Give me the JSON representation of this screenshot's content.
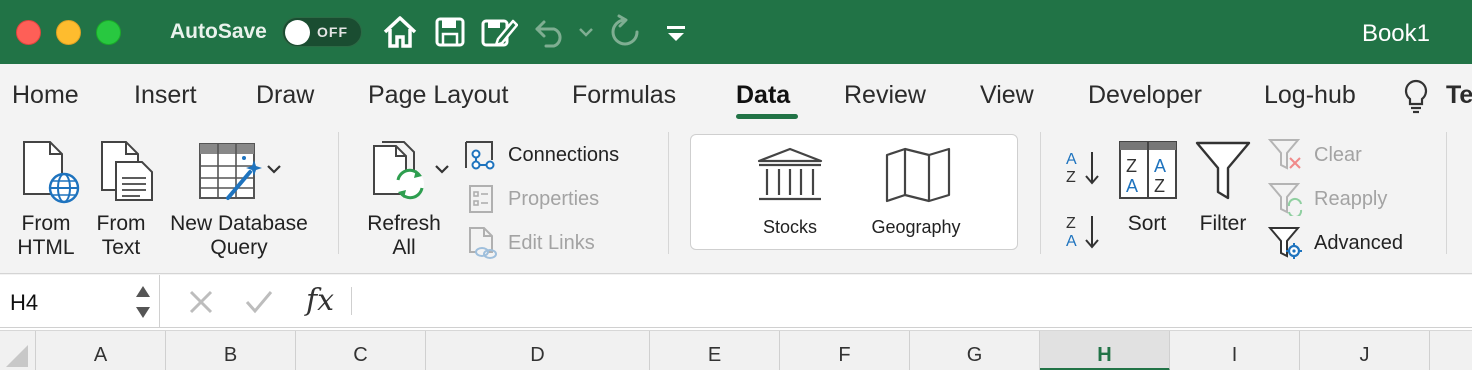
{
  "titlebar": {
    "autosave_label": "AutoSave",
    "autosave_state": "OFF",
    "book_title": "Book1",
    "quick_access": [
      "home-icon",
      "save-icon",
      "edit-save-icon",
      "undo-icon",
      "undo-dropdown-icon",
      "redo-icon",
      "customize-toolbar-icon"
    ],
    "accent_color": "#217346"
  },
  "tabs": {
    "items": [
      "Home",
      "Insert",
      "Draw",
      "Page Layout",
      "Formulas",
      "Data",
      "Review",
      "View",
      "Developer",
      "Log-hub",
      "Te"
    ],
    "active": "Data"
  },
  "ribbon": {
    "get_data": {
      "from_html": [
        "From",
        "HTML"
      ],
      "from_text": [
        "From",
        "Text"
      ],
      "new_db_query": [
        "New Database",
        "Query"
      ]
    },
    "queries": {
      "refresh_all": [
        "Refresh",
        "All"
      ],
      "connections": "Connections",
      "properties": "Properties",
      "edit_links": "Edit Links"
    },
    "data_types": {
      "stocks": "Stocks",
      "geography": "Geography"
    },
    "sort_filter": {
      "sort": "Sort",
      "filter": "Filter",
      "clear": "Clear",
      "reapply": "Reapply",
      "advanced": "Advanced"
    }
  },
  "formula_bar": {
    "name_box": "H4",
    "fx": "fx",
    "formula_value": ""
  },
  "columns": {
    "headers": [
      "A",
      "B",
      "C",
      "D",
      "E",
      "F",
      "G",
      "H",
      "I",
      "J"
    ],
    "selected": "H"
  }
}
